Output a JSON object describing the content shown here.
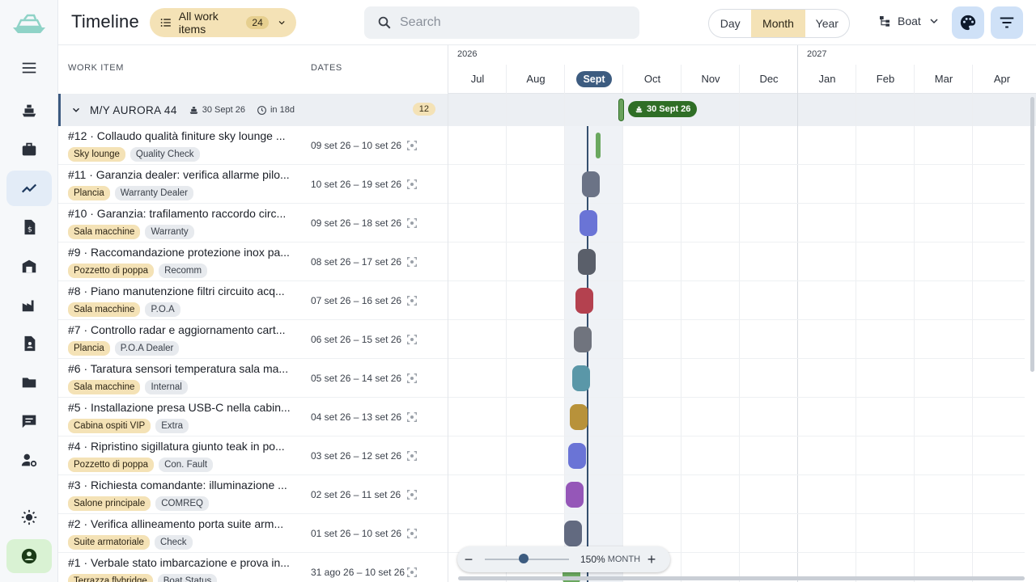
{
  "app": {
    "title": "Timeline"
  },
  "filter": {
    "label": "All work items",
    "count": "24"
  },
  "search": {
    "placeholder": "Search"
  },
  "view_modes": {
    "day": "Day",
    "month": "Month",
    "year": "Year",
    "selected": "Month"
  },
  "group_by": {
    "label": "Boat"
  },
  "table": {
    "col_work_item": "WORK ITEM",
    "col_dates": "DATES",
    "group": {
      "name": "M/Y AURORA 44",
      "date": "30 Sept 26",
      "due": "in 18d",
      "count": "12"
    },
    "rows": [
      {
        "title": "#12 · Collaudo qualità finiture sky lounge ...",
        "location": "Sky lounge",
        "category": "Quality Check",
        "dates": "09 set 26 – 10 set 26",
        "color": "#6aa85f"
      },
      {
        "title": "#11 · Garanzia dealer: verifica allarme pilo...",
        "location": "Plancia",
        "category": "Warranty Dealer",
        "dates": "10 set 26 – 19 set 26",
        "color": "#6b7386"
      },
      {
        "title": "#10 · Garanzia: trafilamento raccordo circ...",
        "location": "Sala macchine",
        "category": "Warranty",
        "dates": "09 set 26 – 18 set 26",
        "color": "#6a74d6"
      },
      {
        "title": "#9 · Raccomandazione protezione inox pa...",
        "location": "Pozzetto di poppa",
        "category": "Recomm",
        "dates": "08 set 26 – 17 set 26",
        "color": "#5a5f6a"
      },
      {
        "title": "#8 · Piano manutenzione filtri circuito acq...",
        "location": "Sala macchine",
        "category": "P.O.A",
        "dates": "07 set 26 – 16 set 26",
        "color": "#b4414f"
      },
      {
        "title": "#7 · Controllo radar e aggiornamento cart...",
        "location": "Plancia",
        "category": "P.O.A Dealer",
        "dates": "06 set 26 – 15 set 26",
        "color": "#70747e"
      },
      {
        "title": "#6 · Taratura sensori temperatura sala ma...",
        "location": "Sala macchine",
        "category": "Internal",
        "dates": "05 set 26 – 14 set 26",
        "color": "#5a97a8"
      },
      {
        "title": "#5 · Installazione presa USB-C nella cabin...",
        "location": "Cabina ospiti VIP",
        "category": "Extra",
        "dates": "04 set 26 – 13 set 26",
        "color": "#b8923a"
      },
      {
        "title": "#4 · Ripristino sigillatura giunto teak in po...",
        "location": "Pozzetto di poppa",
        "category": "Con. Fault",
        "dates": "03 set 26 – 12 set 26",
        "color": "#6a74d6"
      },
      {
        "title": "#3 · Richiesta comandante: illuminazione ...",
        "location": "Salone principale",
        "category": "COMREQ",
        "dates": "02 set 26 – 11 set 26",
        "color": "#9557b8"
      },
      {
        "title": "#2 · Verifica allineamento porta suite arm...",
        "location": "Suite armatoriale",
        "category": "Check",
        "dates": "01 set 26 – 10 set 26",
        "color": "#626a80"
      },
      {
        "title": "#1 · Verbale stato imbarcazione e prova in...",
        "location": "Terrazza flybridge",
        "category": "Boat Status",
        "dates": "31 ago 26 – 10 set 26",
        "color": "#6aa85f"
      }
    ]
  },
  "timeline": {
    "years": [
      "2026",
      "2027"
    ],
    "months": [
      "Jul",
      "Aug",
      "Sept",
      "Oct",
      "Nov",
      "Dec",
      "Jan",
      "Feb",
      "Mar",
      "Apr"
    ],
    "current_month": "Sept",
    "milestone_label": "30 Sept 26"
  },
  "zoom": {
    "percent": "150%",
    "unit": "MONTH",
    "level": 0.4
  },
  "icons": {
    "logo": "boat-logo-icon",
    "sidebar": [
      "menu-icon",
      "ship-icon",
      "briefcase-icon",
      "timeline-icon",
      "invoice-icon",
      "warehouse-icon",
      "factory-icon",
      "contact-file-icon",
      "folder-icon",
      "chat-icon",
      "user-settings-icon",
      "theme-sun-icon",
      "account-icon"
    ]
  },
  "colors": {
    "accent": "#3d5c80",
    "highlight": "#f4e2b6",
    "milestone": "#2f6e26",
    "active_nav": "#e3ecf7"
  }
}
